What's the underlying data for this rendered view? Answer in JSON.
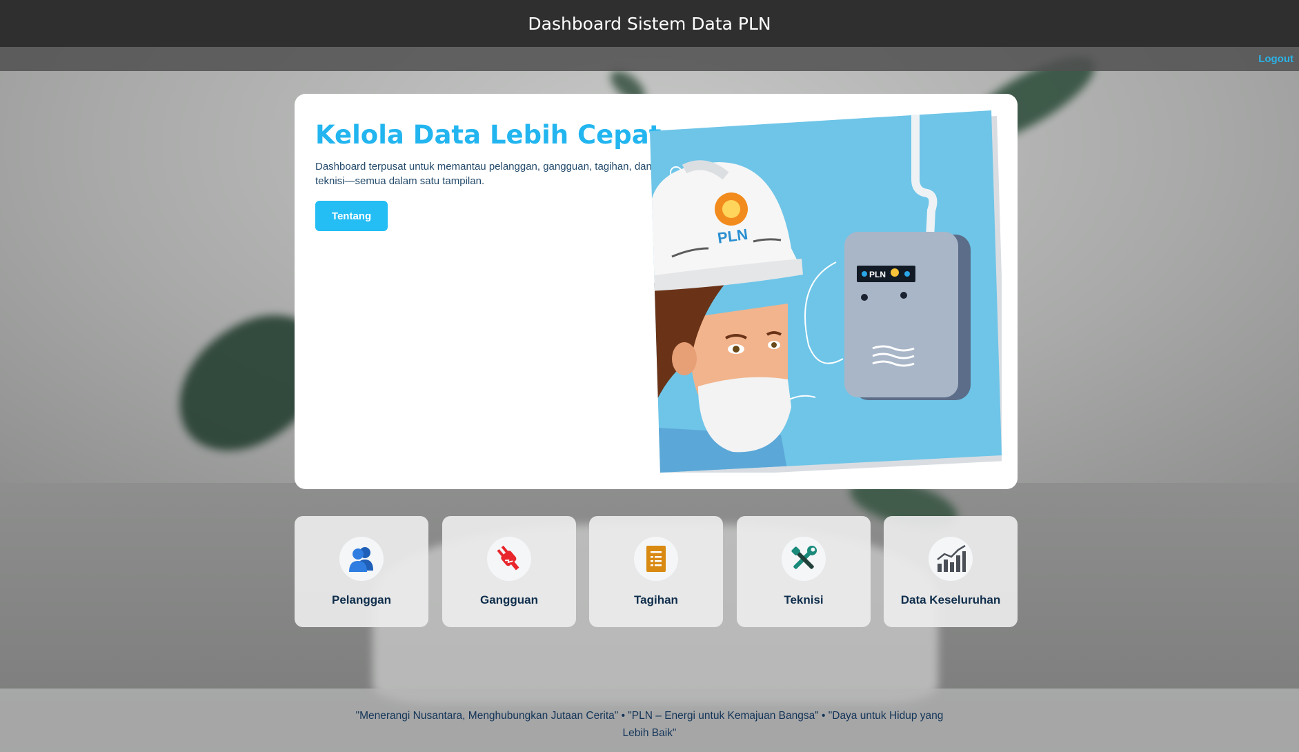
{
  "header": {
    "title": "Dashboard Sistem Data PLN",
    "logout_label": "Logout"
  },
  "hero": {
    "title": "Kelola Data Lebih Cepat",
    "description": "Dashboard terpusat untuk memantau pelanggan, gangguan, tagihan, dan teknisi—semua dalam satu tampilan.",
    "button_label": "Tentang",
    "illustration": {
      "helmet_label": "PLN",
      "device_label": "PLN"
    }
  },
  "menu": [
    {
      "label": "Pelanggan",
      "icon": "users-icon",
      "color": "#2f7de1"
    },
    {
      "label": "Gangguan",
      "icon": "plug-icon",
      "color": "#e8262b"
    },
    {
      "label": "Tagihan",
      "icon": "invoice-icon",
      "color": "#d98a12"
    },
    {
      "label": "Teknisi",
      "icon": "tools-icon",
      "color": "#1a8a7a"
    },
    {
      "label": "Data Keseluruhan",
      "icon": "bar-chart-icon",
      "color": "#4a4f57"
    }
  ],
  "footer": {
    "quotes": "\"Menerangi Nusantara, Menghubungkan Jutaan Cerita\"  •  \"PLN – Energi untuk Kemajuan Bangsa\"  •  \"Daya untuk Hidup yang Lebih Baik\""
  },
  "colors": {
    "accent": "#24bdf4",
    "header_bg": "#2f2f2f",
    "title_blue": "#22b5ef",
    "label_navy": "#0f2e4c"
  }
}
